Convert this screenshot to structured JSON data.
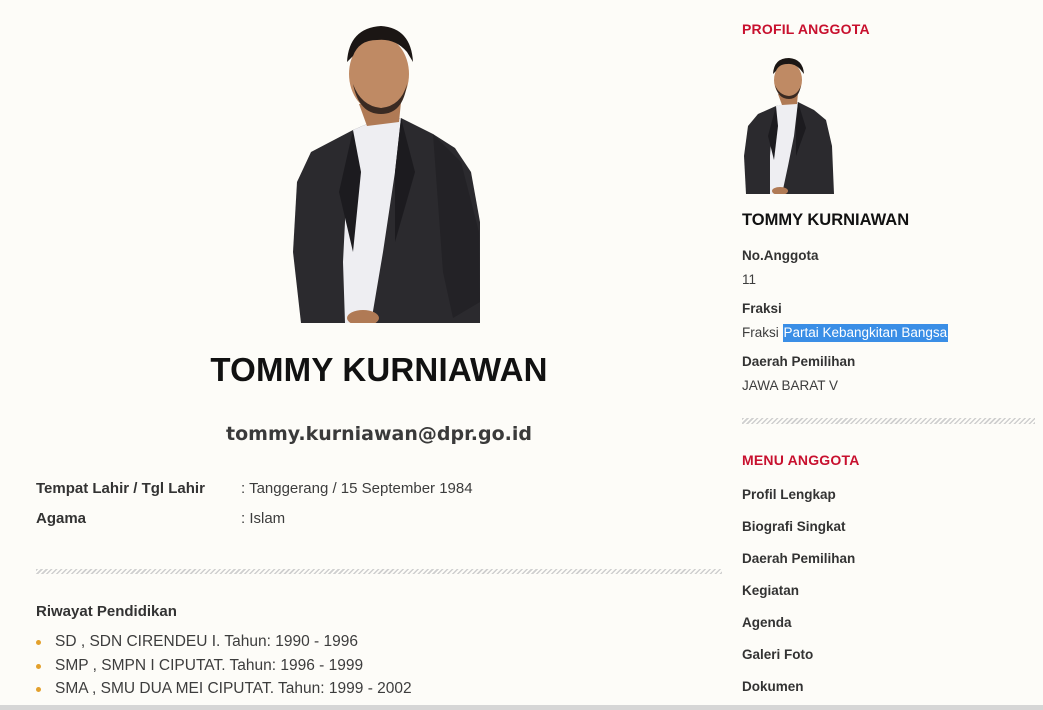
{
  "profile": {
    "name": "TOMMY KURNIAWAN",
    "email": "tommy.kurniawan@dpr.go.id",
    "info": [
      {
        "label": "Tempat Lahir / Tgl Lahir",
        "value": ": Tanggerang / 15 September 1984"
      },
      {
        "label": "Agama",
        "value": ": Islam"
      }
    ],
    "education_title": "Riwayat Pendidikan",
    "education": [
      "SD , SDN CIRENDEU I. Tahun: 1990 - 1996",
      "SMP , SMPN I CIPUTAT. Tahun: 1996 - 1999",
      "SMA , SMU DUA MEI CIPUTAT. Tahun: 1999 - 2002"
    ]
  },
  "sidebar": {
    "profil_heading": "PROFIL ANGGOTA",
    "name": "TOMMY KURNIAWAN",
    "no_anggota_label": "No.Anggota",
    "no_anggota_value": "11",
    "fraksi_label": "Fraksi",
    "fraksi_prefix": "Fraksi ",
    "fraksi_highlighted": "Partai Kebangkitan Bangsa",
    "dapil_label": "Daerah Pemilihan",
    "dapil_value": "JAWA BARAT V",
    "menu_heading": "MENU ANGGOTA",
    "menu": [
      "Profil Lengkap",
      "Biografi Singkat",
      "Daerah Pemilihan",
      "Kegiatan",
      "Agenda",
      "Galeri Foto",
      "Dokumen"
    ]
  },
  "colors": {
    "accent": "#c8102e",
    "bullet": "#e3a02c",
    "highlight": "#3a8ee6",
    "background": "#fdfcf8"
  }
}
